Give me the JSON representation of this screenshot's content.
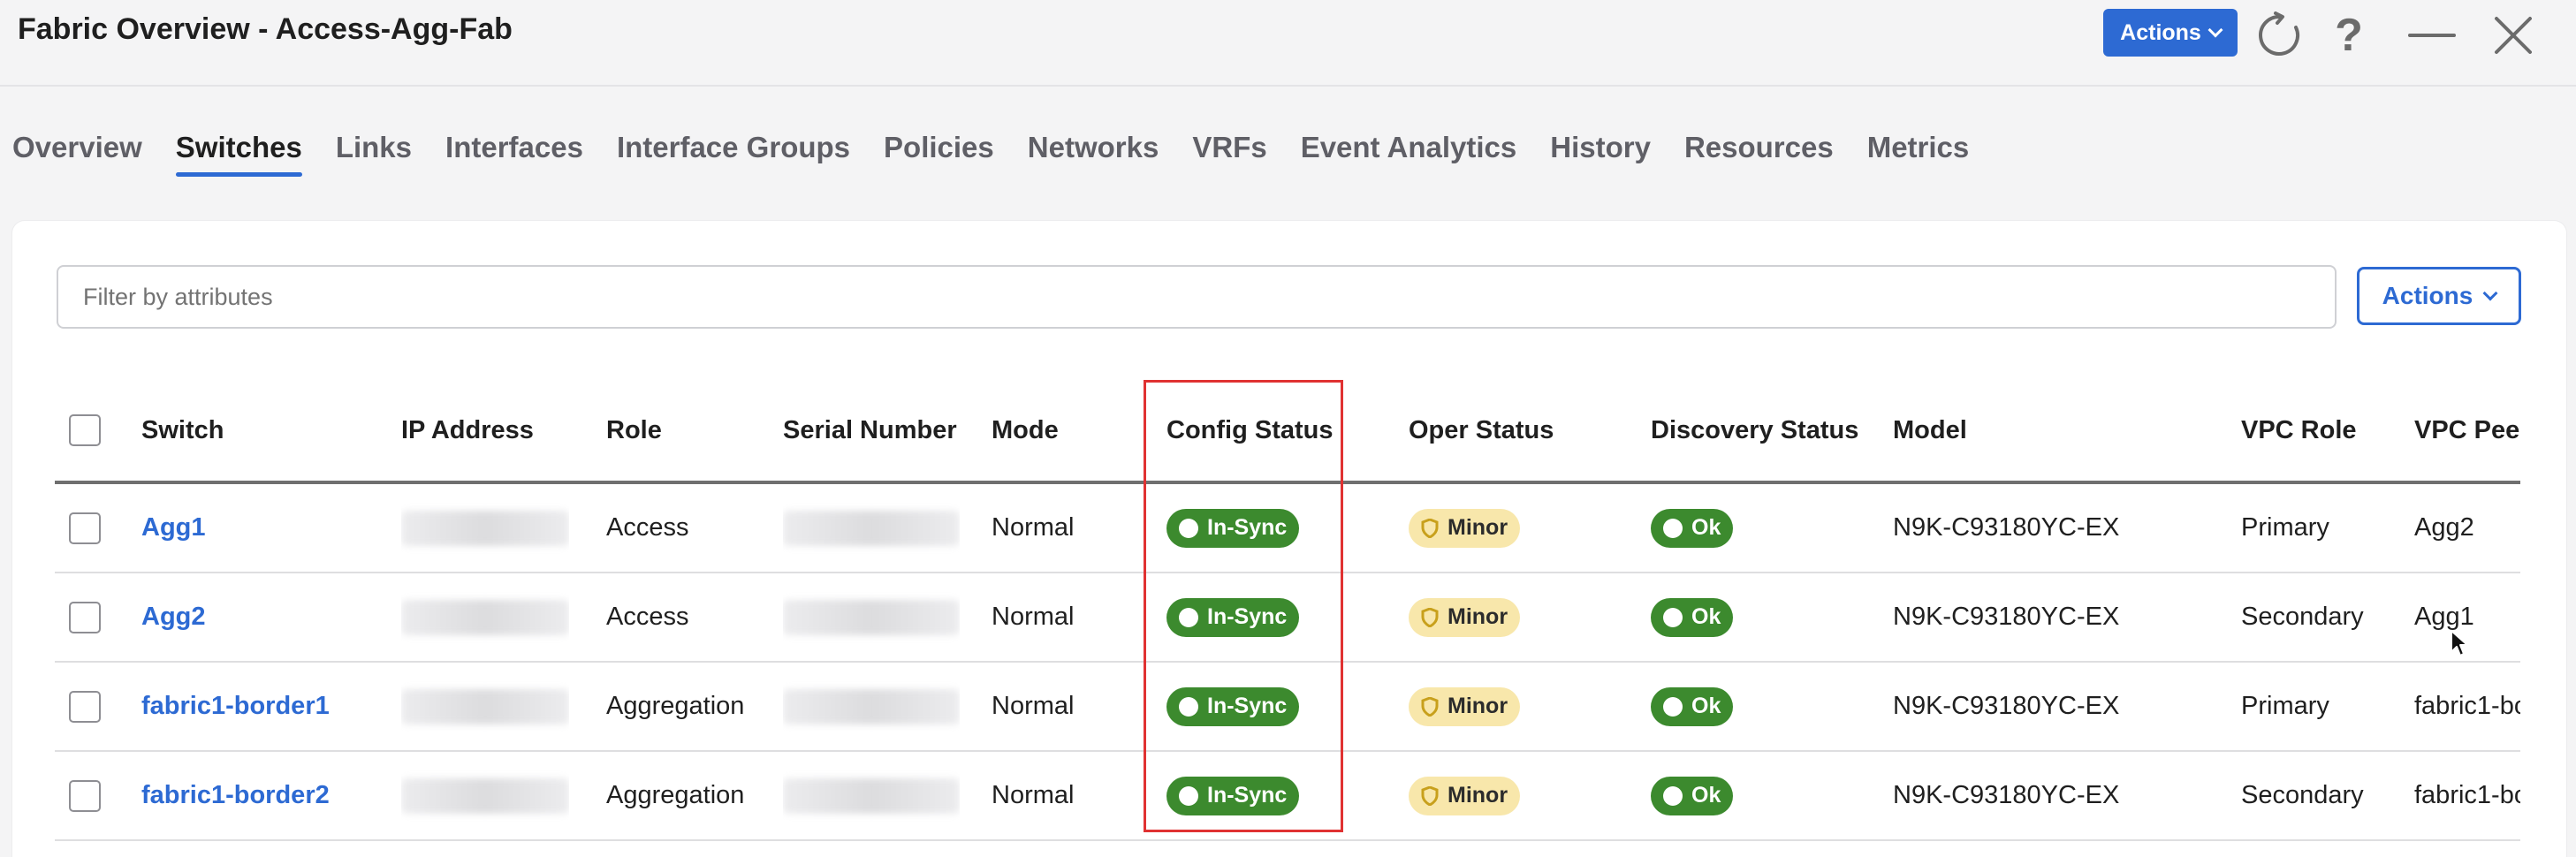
{
  "window": {
    "title": "Fabric Overview - Access-Agg-Fab",
    "actions_label": "Actions"
  },
  "tabs": [
    {
      "label": "Overview",
      "active": false
    },
    {
      "label": "Switches",
      "active": true
    },
    {
      "label": "Links",
      "active": false
    },
    {
      "label": "Interfaces",
      "active": false
    },
    {
      "label": "Interface Groups",
      "active": false
    },
    {
      "label": "Policies",
      "active": false
    },
    {
      "label": "Networks",
      "active": false
    },
    {
      "label": "VRFs",
      "active": false
    },
    {
      "label": "Event Analytics",
      "active": false
    },
    {
      "label": "History",
      "active": false
    },
    {
      "label": "Resources",
      "active": false
    },
    {
      "label": "Metrics",
      "active": false
    }
  ],
  "filter": {
    "placeholder": "Filter by attributes",
    "actions_label": "Actions"
  },
  "table": {
    "columns": [
      "Switch",
      "IP Address",
      "Role",
      "Serial Number",
      "Mode",
      "Config Status",
      "Oper Status",
      "Discovery Status",
      "Model",
      "VPC Role",
      "VPC Peer"
    ],
    "rows": [
      {
        "switch": "Agg1",
        "role": "Access",
        "mode": "Normal",
        "config_status": "In-Sync",
        "oper_status": "Minor",
        "discovery_status": "Ok",
        "model": "N9K-C93180YC-EX",
        "vpc_role": "Primary",
        "vpc_peer": "Agg2"
      },
      {
        "switch": "Agg2",
        "role": "Access",
        "mode": "Normal",
        "config_status": "In-Sync",
        "oper_status": "Minor",
        "discovery_status": "Ok",
        "model": "N9K-C93180YC-EX",
        "vpc_role": "Secondary",
        "vpc_peer": "Agg1"
      },
      {
        "switch": "fabric1-border1",
        "role": "Aggregation",
        "mode": "Normal",
        "config_status": "In-Sync",
        "oper_status": "Minor",
        "discovery_status": "Ok",
        "model": "N9K-C93180YC-EX",
        "vpc_role": "Primary",
        "vpc_peer": "fabric1-bo"
      },
      {
        "switch": "fabric1-border2",
        "role": "Aggregation",
        "mode": "Normal",
        "config_status": "In-Sync",
        "oper_status": "Minor",
        "discovery_status": "Ok",
        "model": "N9K-C93180YC-EX",
        "vpc_role": "Secondary",
        "vpc_peer": "fabric1-bo"
      }
    ]
  },
  "colors": {
    "accent": "#2d6ad3",
    "status_green": "#3c8a2e",
    "minor_yellow": "#f8e7ab",
    "highlight_red": "#e03232"
  }
}
